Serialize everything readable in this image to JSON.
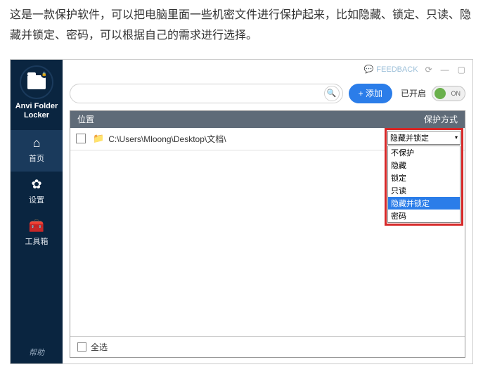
{
  "intro": "这是一款保护软件，可以把电脑里面一些机密文件进行保护起来，比如隐藏、锁定、只读、隐藏并锁定、密码，可以根据自己的需求进行选择。",
  "app_name": "Anvi Folder Locker",
  "sidebar": {
    "items": [
      {
        "label": "首页"
      },
      {
        "label": "设置"
      },
      {
        "label": "工具箱"
      }
    ],
    "footer": "帮助"
  },
  "top": {
    "feedback": "FEEDBACK"
  },
  "toolbar": {
    "search_placeholder": "",
    "add_label": "+ 添加",
    "toggle_label": "已开启",
    "toggle_state": "ON"
  },
  "table": {
    "header_location": "位置",
    "header_method": "保护方式",
    "row_path": "C:\\Users\\Mloong\\Desktop\\文档\\",
    "row_selected": "隐藏并锁定",
    "dropdown_selected": "隐藏并锁定",
    "dropdown_options": [
      "不保护",
      "隐藏",
      "锁定",
      "只读",
      "隐藏并锁定",
      "密码"
    ],
    "highlighted_index": 4,
    "footer_select_all": "全选"
  }
}
